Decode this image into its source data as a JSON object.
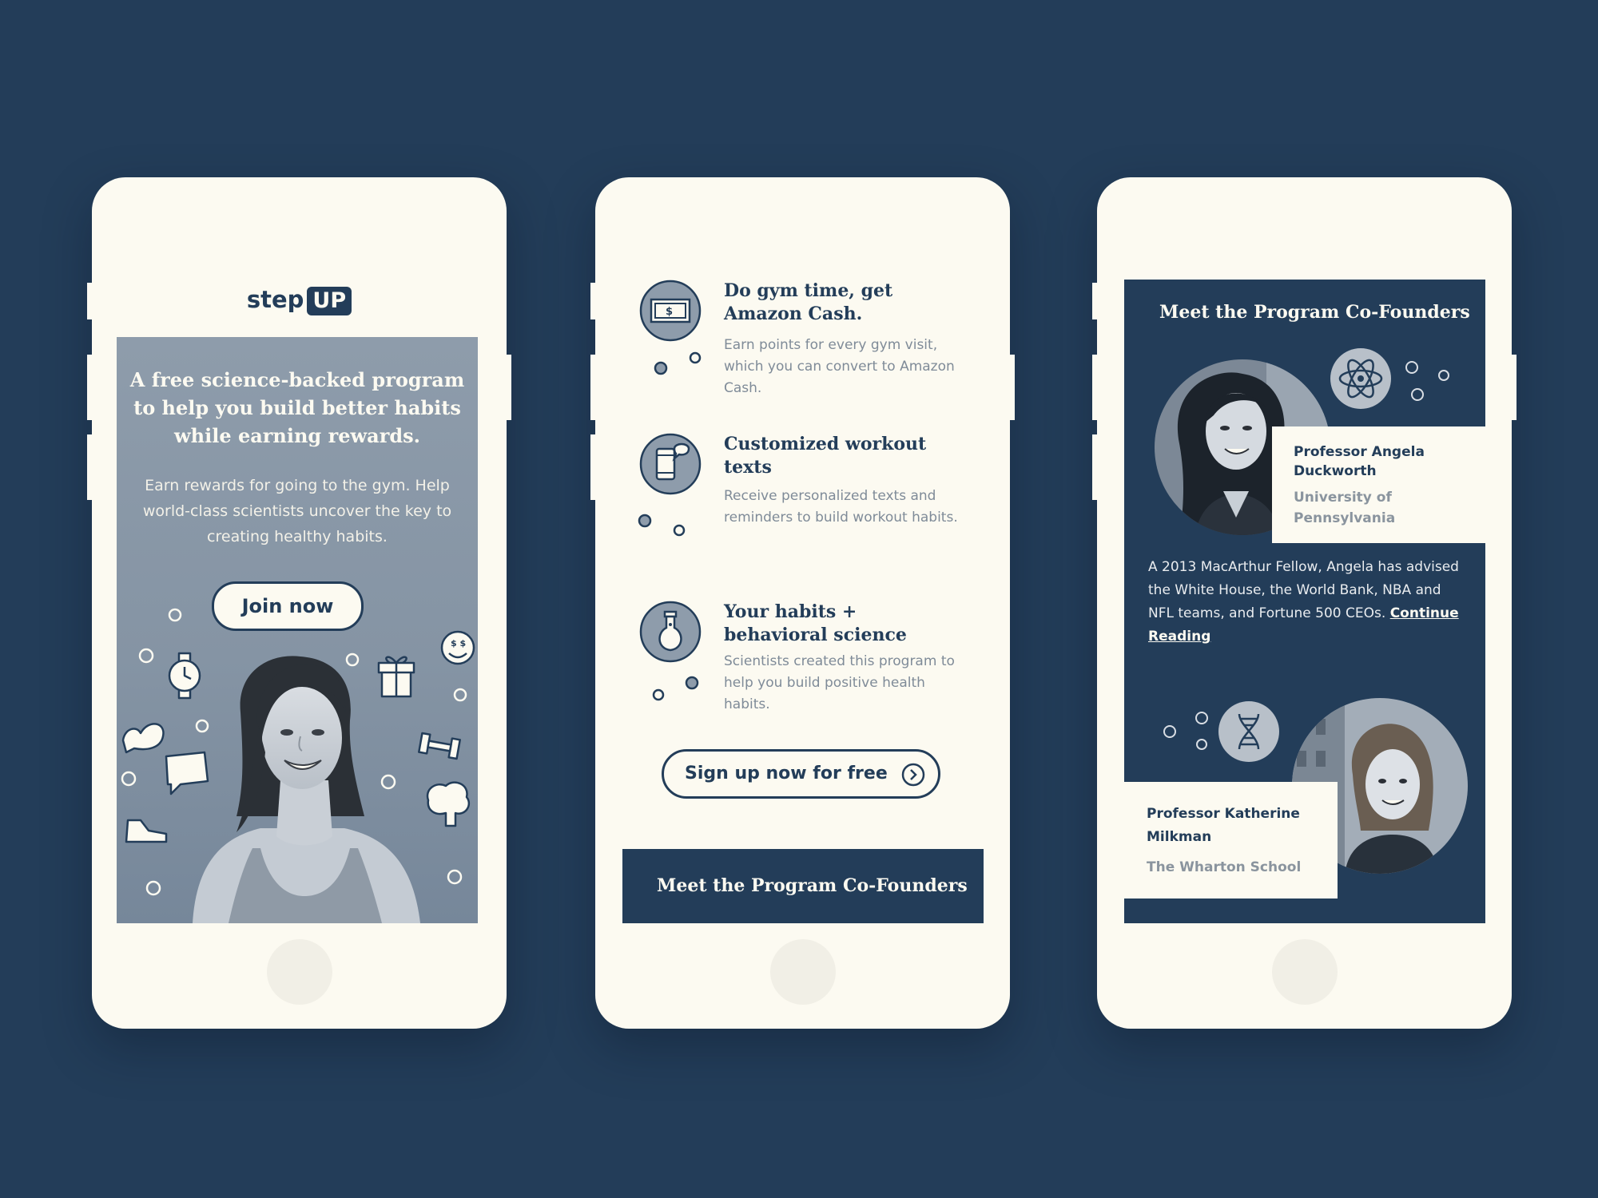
{
  "screen1": {
    "logo": {
      "word": "step",
      "badge": "UP"
    },
    "headline": "A free science-backed program to help you build better habits while earning rewards.",
    "subtext": "Earn rewards for going to the gym. Help world-class scientists uncover the key to creating healthy habits.",
    "join_button": "Join now",
    "doodle_icons": [
      "watch-icon",
      "muscle-arm-icon",
      "chat-bubble-icon",
      "sneaker-icon",
      "gift-icon",
      "dumbbell-icon",
      "brain-icon",
      "money-smile-icon"
    ]
  },
  "screen2": {
    "features": [
      {
        "title": "Do gym time, get Amazon Cash.",
        "text": "Earn points for every gym visit, which you can convert to Amazon Cash.",
        "icon": "cash-icon"
      },
      {
        "title": "Customized workout texts",
        "text": "Receive personalized texts and reminders to build workout habits.",
        "icon": "phone-message-icon"
      },
      {
        "title": "Your habits + behavioral science",
        "text": "Scientists created this program to help you build positive health habits.",
        "icon": "flask-icon"
      }
    ],
    "signup_button": "Sign up now for free",
    "meet_bar": "Meet the Program Co-Founders"
  },
  "screen3": {
    "title": "Meet the Program Co-Founders",
    "founder1": {
      "name": "Professor Angela Duckworth",
      "school": "University of Pennsylvania",
      "icon": "atom-icon"
    },
    "bio_text": "A 2013 MacArthur Fellow, Angela has advised the White House, the World Bank, NBA and NFL teams, and Fortune 500 CEOs.",
    "bio_link": "Continue Reading",
    "founder2": {
      "name": "Professor Katherine Milkman",
      "school": "The Wharton School",
      "icon": "dna-icon"
    }
  },
  "colors": {
    "background": "#233d59",
    "cream": "#fcfaf1",
    "muted": "#7f8b98",
    "icon_fill": "#8e9cab"
  }
}
